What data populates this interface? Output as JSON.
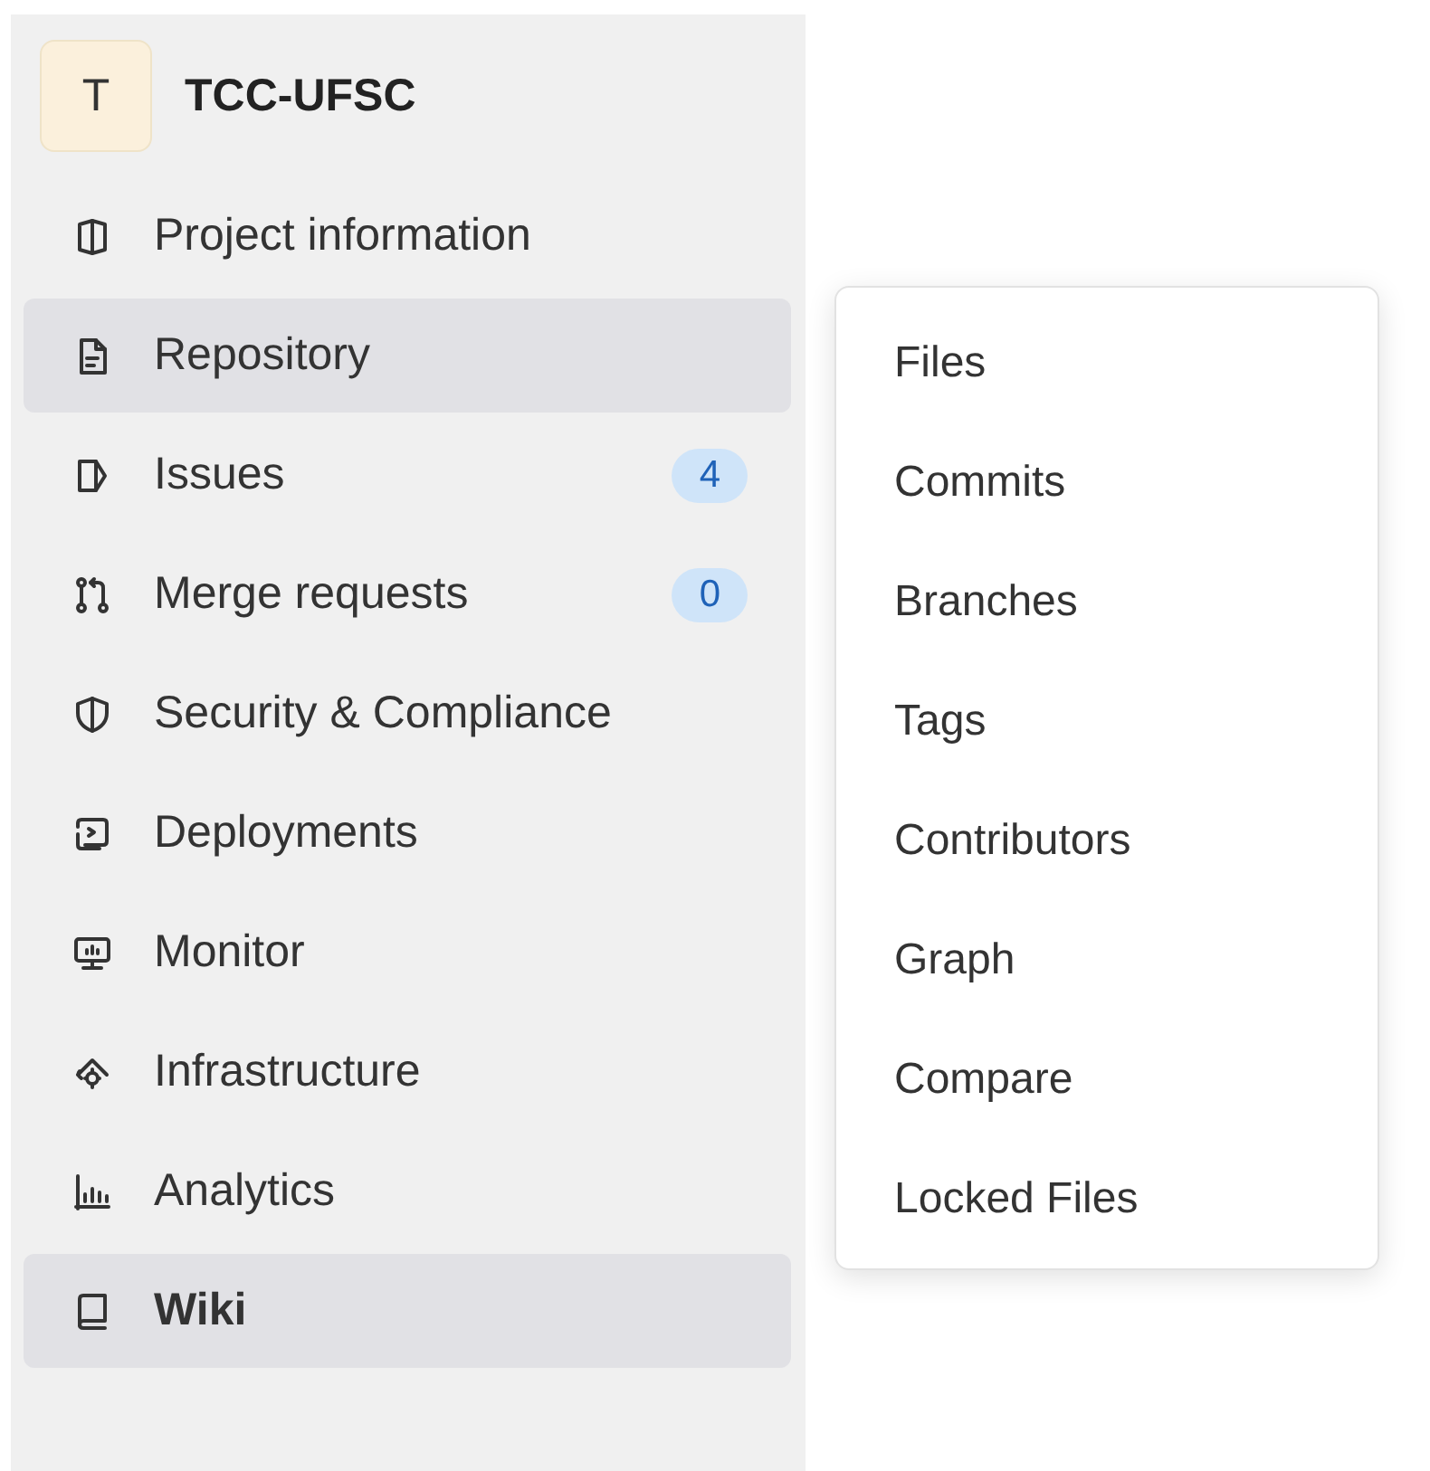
{
  "project": {
    "avatar": "T",
    "name": "TCC-UFSC"
  },
  "sidebar": {
    "items": [
      {
        "label": "Project information",
        "selected": false,
        "hovered": false
      },
      {
        "label": "Repository",
        "selected": false,
        "hovered": true
      },
      {
        "label": "Issues",
        "selected": false,
        "hovered": false,
        "badge": "4"
      },
      {
        "label": "Merge requests",
        "selected": false,
        "hovered": false,
        "badge": "0"
      },
      {
        "label": "Security & Compliance",
        "selected": false,
        "hovered": false
      },
      {
        "label": "Deployments",
        "selected": false,
        "hovered": false
      },
      {
        "label": "Monitor",
        "selected": false,
        "hovered": false
      },
      {
        "label": "Infrastructure",
        "selected": false,
        "hovered": false
      },
      {
        "label": "Analytics",
        "selected": false,
        "hovered": false
      },
      {
        "label": "Wiki",
        "selected": true,
        "hovered": false
      }
    ]
  },
  "flyout": {
    "items": [
      "Files",
      "Commits",
      "Branches",
      "Tags",
      "Contributors",
      "Graph",
      "Compare",
      "Locked Files"
    ]
  }
}
